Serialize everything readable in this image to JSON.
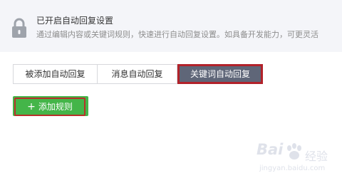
{
  "notice": {
    "icon": "lock-icon",
    "title": "已开启自动回复设置",
    "description": "通过编辑内容或关键词规则，快速进行自动回复设置。如具备开发能力，可更灵活"
  },
  "tabs": [
    {
      "label": "被添加自动回复",
      "active": false
    },
    {
      "label": "消息自动回复",
      "active": false
    },
    {
      "label": "关键词自动回复",
      "active": true
    }
  ],
  "add_rule_button": {
    "icon": "plus-icon",
    "label": "添加规则"
  },
  "watermark": {
    "brand": "Bai",
    "brand_cn": "经验",
    "url": "jingyan.baidu.com"
  },
  "colors": {
    "notice_bg": "#f4f5f9",
    "active_tab_bg": "#5f6678",
    "highlight_border": "#b2222a",
    "button_green": "#44b549"
  }
}
